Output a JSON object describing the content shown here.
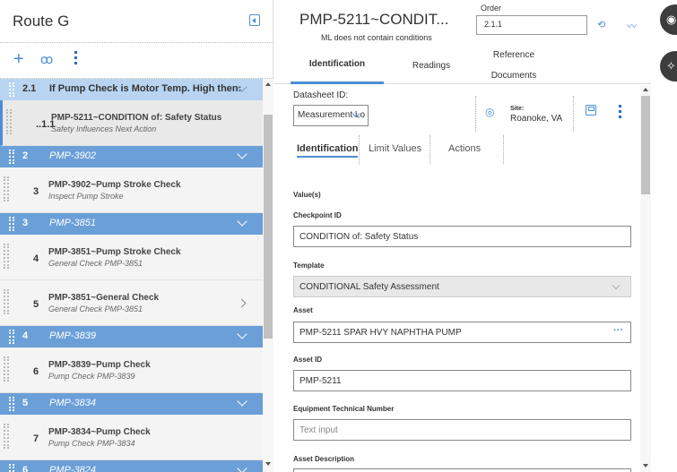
{
  "left": {
    "title": "Route G",
    "toolbar": {
      "add": "+",
      "find": "ꝏ"
    },
    "rows": [
      {
        "kind": "group",
        "num": "2.1",
        "label": "If Pump Check is Motor Temp. High then:",
        "style": "light"
      },
      {
        "kind": "item",
        "num": "..1.1",
        "title": "PMP-5211~CONDITION of: Safety Status",
        "sub": "Safety Influences Next Action",
        "selected": true
      },
      {
        "kind": "group",
        "num": "2",
        "label": "PMP-3902"
      },
      {
        "kind": "item",
        "num": "3",
        "title": "PMP-3902~Pump Stroke Check",
        "sub": "Inspect Pump Stroke"
      },
      {
        "kind": "group",
        "num": "3",
        "label": "PMP-3851"
      },
      {
        "kind": "item",
        "num": "4",
        "title": "PMP-3851~Pump Stroke Check",
        "sub": "General Check PMP-3851"
      },
      {
        "kind": "item",
        "num": "5",
        "title": "PMP-3851~General Check",
        "sub": "General Check PMP-3851",
        "arrow": true
      },
      {
        "kind": "group",
        "num": "4",
        "label": "PMP-3839"
      },
      {
        "kind": "item",
        "num": "6",
        "title": "PMP-3839~Pump Check",
        "sub": "Pump Check PMP-3839"
      },
      {
        "kind": "group",
        "num": "5",
        "label": "PMP-3834"
      },
      {
        "kind": "item",
        "num": "7",
        "title": "PMP-3834~Pump Check",
        "sub": "Pump Check PMP-3834"
      },
      {
        "kind": "group",
        "num": "6",
        "label": "PMP-3824"
      }
    ]
  },
  "right": {
    "title": "PMP-5211~CONDIT...",
    "subtitle": "ML does not contain conditions",
    "order_label": "Order",
    "order_value": "2.1.1",
    "tabs": [
      "Identification",
      "Readings",
      "Reference",
      "Documents"
    ],
    "datasheet_label": "Datasheet ID:",
    "datasheet_value": "Measurement Lo",
    "site_label": "Site:",
    "site_value": "Roanoke, VA",
    "subtabs": [
      "Identification",
      "Limit Values",
      "Actions"
    ],
    "section": "Value(s)",
    "fields": {
      "checkpoint_id_label": "Checkpoint ID",
      "checkpoint_id_value": "CONDITION of: Safety Status",
      "template_label": "Template",
      "template_value": "CONDITIONAL Safety Assessment",
      "asset_label": "Asset",
      "asset_value": "PMP-5211 SPAR HVY NAPHTHA PUMP",
      "asset_id_label": "Asset ID",
      "asset_id_value": "PMP-5211",
      "etn_label": "Equipment Technical Number",
      "etn_placeholder": "Text input",
      "asset_desc_label": "Asset Description"
    }
  }
}
